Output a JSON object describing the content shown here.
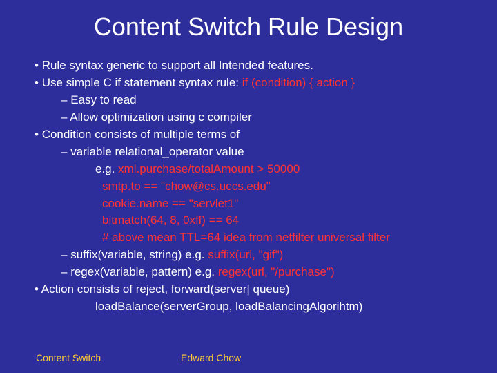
{
  "title": "Content Switch Rule Design",
  "bullets": {
    "b1_1": "Rule syntax generic to support all Intended features.",
    "b1_2a": "Use simple C if statement syntax rule:  ",
    "b1_2b": "if (condition) { action }",
    "b2_1": "Easy to read",
    "b2_2": "Allow optimization using c compiler",
    "b1_3": "Condition consists of multiple terms of",
    "b2_3": "variable relational_operator value",
    "b3_1a": "e.g. ",
    "b3_1b": "xml.purchase/totalAmount > 50000",
    "b3_2": "smtp.to == \"chow@cs.uccs.edu\"",
    "b3_3": " cookie.name == \"servlet1\"",
    "b3_4": "bitmatch(64, 8, 0xff) == 64",
    "b3_5": "# above mean TTL=64 idea from netfilter universal filter",
    "b2_4a": "suffix(variable, string)   e.g.  ",
    "b2_4b": "suffix(url, \"gif\")",
    "b2_5a": "regex(variable, pattern) e.g. ",
    "b2_5b": "regex(url, \"/purchase\")",
    "b1_4": "Action consists of reject, forward(server| queue)",
    "b3_6": "loadBalance(serverGroup, loadBalancingAlgorihtm)"
  },
  "footer": {
    "left": "Content Switch",
    "center": "Edward Chow"
  }
}
